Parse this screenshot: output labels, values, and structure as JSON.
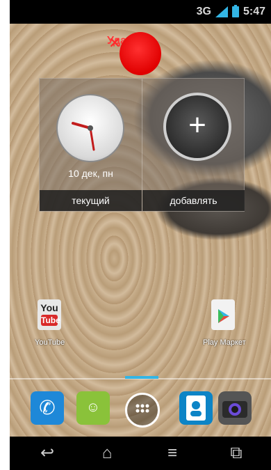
{
  "status_bar": {
    "network": "3G",
    "time": "5:47"
  },
  "remove_target": {
    "label": "Удалить"
  },
  "widgets": [
    {
      "name": "clock",
      "date": "10 дек, пн",
      "caption": "текущий"
    },
    {
      "name": "add",
      "caption": "добавлять"
    }
  ],
  "home_icons": [
    {
      "label": "YouTube",
      "icon": "youtube-icon"
    },
    {
      "label": "Play Маркет",
      "icon": "play-store-icon"
    }
  ],
  "dock": [
    {
      "icon": "phone-icon"
    },
    {
      "icon": "messages-icon"
    },
    {
      "icon": "apps-icon"
    },
    {
      "icon": "contacts-icon"
    },
    {
      "icon": "camera-icon"
    }
  ],
  "nav": [
    "back-icon",
    "home-icon",
    "menu-icon",
    "recent-apps-icon"
  ],
  "colors": {
    "accent": "#33b5e5",
    "remove_red": "#ff2a2a"
  }
}
